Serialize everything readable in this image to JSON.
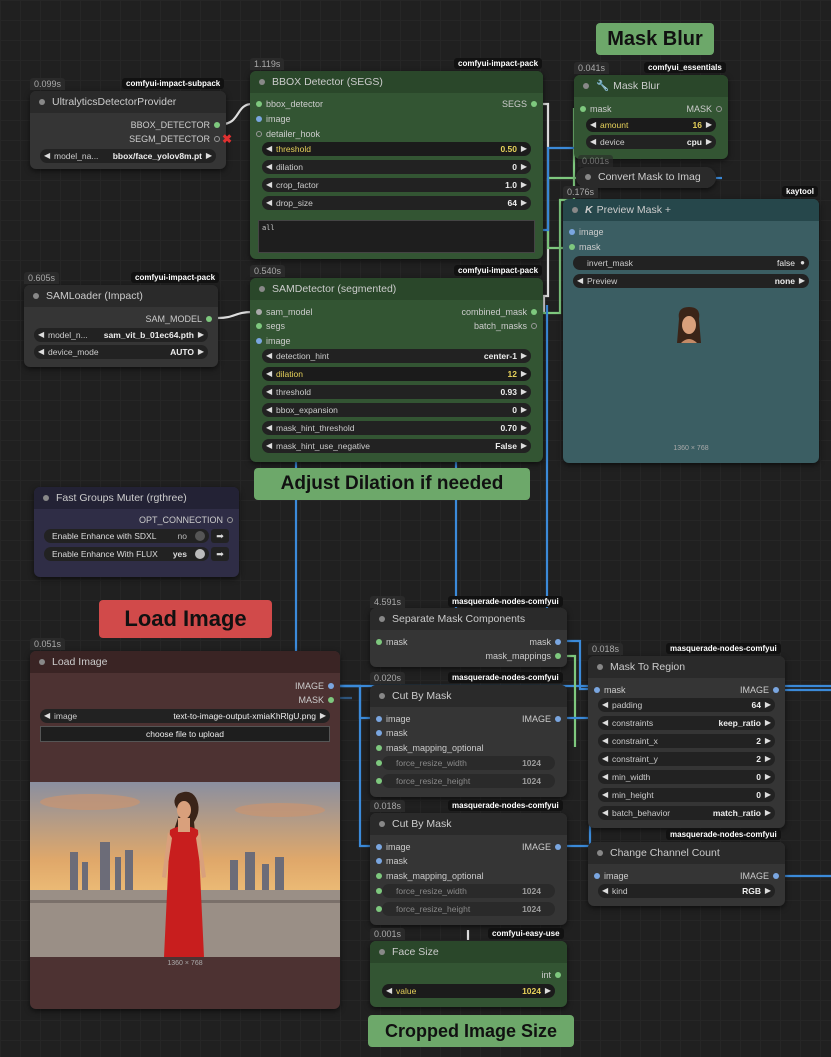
{
  "labels": {
    "mask_blur": "Mask Blur",
    "adjust_dilation": "Adjust Dilation if needed",
    "load_image": "Load Image",
    "cropped_image_size": "Cropped Image Size"
  },
  "nodes": {
    "ultralytics": {
      "timing": "0.099s",
      "pack": "comfyui-impact-subpack",
      "title": "UltralyticsDetectorProvider",
      "outputs": [
        "BBOX_DETECTOR",
        "SEGM_DETECTOR"
      ],
      "model_label": "model_na...",
      "model_value": "bbox/face_yolov8m.pt"
    },
    "bbox_detector": {
      "timing": "1.119s",
      "pack": "comfyui-impact-pack",
      "title": "BBOX Detector (SEGS)",
      "inputs": [
        "bbox_detector",
        "image",
        "detailer_hook"
      ],
      "output": "SEGS",
      "widgets": [
        {
          "label": "threshold",
          "value": "0.50"
        },
        {
          "label": "dilation",
          "value": "0"
        },
        {
          "label": "crop_factor",
          "value": "1.0"
        },
        {
          "label": "drop_size",
          "value": "64"
        }
      ],
      "text": "all"
    },
    "samloader": {
      "timing": "0.605s",
      "pack": "comfyui-impact-pack",
      "title": "SAMLoader (Impact)",
      "output": "SAM_MODEL",
      "widgets": [
        {
          "label": "model_n...",
          "value": "sam_vit_b_01ec64.pth"
        },
        {
          "label": "device_mode",
          "value": "AUTO"
        }
      ]
    },
    "samdetector": {
      "timing": "0.540s",
      "pack": "comfyui-impact-pack",
      "title": "SAMDetector (segmented)",
      "inputs": [
        "sam_model",
        "segs",
        "image"
      ],
      "outputs": [
        "combined_mask",
        "batch_masks"
      ],
      "widgets": [
        {
          "label": "detection_hint",
          "value": "center-1"
        },
        {
          "label": "dilation",
          "value": "12"
        },
        {
          "label": "threshold",
          "value": "0.93"
        },
        {
          "label": "bbox_expansion",
          "value": "0"
        },
        {
          "label": "mask_hint_threshold",
          "value": "0.70"
        },
        {
          "label": "mask_hint_use_negative",
          "value": "False"
        }
      ]
    },
    "mask_blur": {
      "timing": "0.041s",
      "pack": "comfyui_essentials",
      "title": "Mask Blur",
      "input": "mask",
      "output": "MASK",
      "widgets": [
        {
          "label": "amount",
          "value": "16"
        },
        {
          "label": "device",
          "value": "cpu"
        }
      ]
    },
    "convert_mask": {
      "timing": "0.001s",
      "title": "Convert Mask to Imag"
    },
    "preview_mask": {
      "timing": "0.176s",
      "pack": "kaytool",
      "title": "Preview Mask +",
      "title_prefix": "K",
      "inputs": [
        "image",
        "mask"
      ],
      "widgets": [
        {
          "label": "invert_mask",
          "value": "false"
        },
        {
          "label": "Preview",
          "value": "none"
        }
      ],
      "caption": "1360 × 768"
    },
    "fast_groups": {
      "title": "Fast Groups Muter (rgthree)",
      "output": "OPT_CONNECTION",
      "toggles": [
        {
          "label": "Enable Enhance with SDXL",
          "value": "no"
        },
        {
          "label": "Enable Enhance With FLUX",
          "value": "yes"
        }
      ]
    },
    "load_image": {
      "timing": "0.051s",
      "title": "Load Image",
      "outputs": [
        "IMAGE",
        "MASK"
      ],
      "image_label": "image",
      "image_value": "text-to-image-output-xmiaKhRlgU.png",
      "upload_label": "choose file to upload",
      "caption": "1360 × 768"
    },
    "separate_mask": {
      "timing": "4.591s",
      "pack": "masquerade-nodes-comfyui",
      "title": "Separate Mask Components",
      "input": "mask",
      "outputs": [
        "mask",
        "mask_mappings"
      ]
    },
    "cut_by_mask_1": {
      "timing": "0.020s",
      "pack": "masquerade-nodes-comfyui",
      "title": "Cut By Mask",
      "inputs": [
        "image",
        "mask",
        "mask_mapping_optional"
      ],
      "output": "IMAGE",
      "widgets": [
        {
          "label": "force_resize_width",
          "value": "1024"
        },
        {
          "label": "force_resize_height",
          "value": "1024"
        }
      ]
    },
    "cut_by_mask_2": {
      "timing": "0.018s",
      "pack": "masquerade-nodes-comfyui",
      "title": "Cut By Mask",
      "inputs": [
        "image",
        "mask",
        "mask_mapping_optional"
      ],
      "output": "IMAGE",
      "widgets": [
        {
          "label": "force_resize_width",
          "value": "1024"
        },
        {
          "label": "force_resize_height",
          "value": "1024"
        }
      ]
    },
    "mask_to_region": {
      "timing": "0.018s",
      "pack": "masquerade-nodes-comfyui",
      "title": "Mask To Region",
      "input": "mask",
      "output": "IMAGE",
      "widgets": [
        {
          "label": "padding",
          "value": "64"
        },
        {
          "label": "constraints",
          "value": "keep_ratio"
        },
        {
          "label": "constraint_x",
          "value": "2"
        },
        {
          "label": "constraint_y",
          "value": "2"
        },
        {
          "label": "min_width",
          "value": "0"
        },
        {
          "label": "min_height",
          "value": "0"
        },
        {
          "label": "batch_behavior",
          "value": "match_ratio"
        }
      ]
    },
    "change_channel": {
      "pack": "masquerade-nodes-comfyui",
      "title": "Change Channel Count",
      "input": "image",
      "output": "IMAGE",
      "widgets": [
        {
          "label": "kind",
          "value": "RGB"
        }
      ]
    },
    "face_size": {
      "timing": "0.001s",
      "pack": "comfyui-easy-use",
      "title": "Face Size",
      "output": "int",
      "widgets": [
        {
          "label": "value",
          "value": "1024"
        }
      ]
    }
  }
}
